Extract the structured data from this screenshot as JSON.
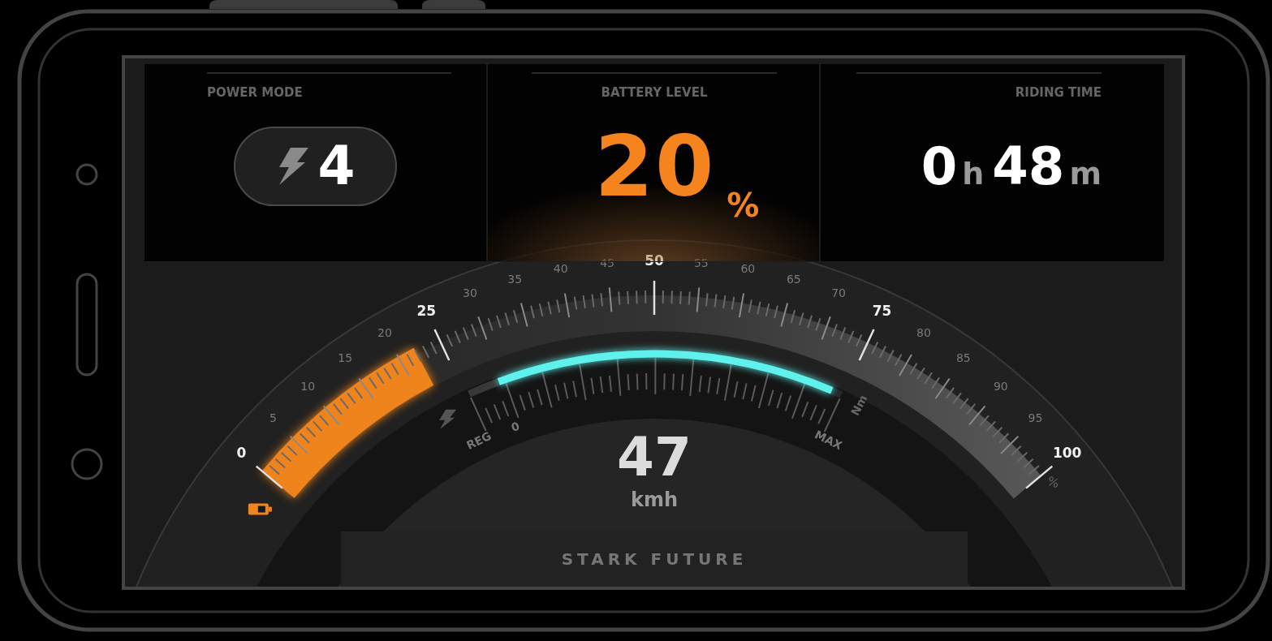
{
  "cards": [
    {
      "kind": "mode",
      "label": "POWER MODE",
      "value": "4"
    },
    {
      "kind": "battery",
      "label": "BATTERY LEVEL",
      "value": "20",
      "unit": "%"
    },
    {
      "kind": "time",
      "label": "RIDING TIME",
      "parts": [
        {
          "value": "0",
          "unit": "h"
        },
        {
          "value": "48",
          "unit": "m"
        }
      ]
    }
  ],
  "power_gauge": {
    "level": 0.22,
    "unit": "%",
    "labels": [
      {
        "text": "0",
        "major": true
      },
      {
        "text": "5",
        "major": false
      },
      {
        "text": "10",
        "major": false
      },
      {
        "text": "15",
        "major": false
      },
      {
        "text": "20",
        "major": false
      },
      {
        "text": "25",
        "major": true
      },
      {
        "text": "30",
        "major": false
      },
      {
        "text": "35",
        "major": false
      },
      {
        "text": "40",
        "major": false
      },
      {
        "text": "45",
        "major": false
      },
      {
        "text": "50",
        "major": true
      },
      {
        "text": "55",
        "major": false
      },
      {
        "text": "60",
        "major": false
      },
      {
        "text": "65",
        "major": false
      },
      {
        "text": "70",
        "major": false
      },
      {
        "text": "75",
        "major": true
      },
      {
        "text": "80",
        "major": false
      },
      {
        "text": "85",
        "major": false
      },
      {
        "text": "90",
        "major": false
      },
      {
        "text": "95",
        "major": false
      },
      {
        "text": "100",
        "major": true
      }
    ]
  },
  "torque_gauge": {
    "level": 0.97,
    "labels": [
      "REG",
      "0",
      "MAX"
    ],
    "unit": "Nm"
  },
  "speed": {
    "value": "47",
    "unit": "kmh"
  },
  "brand": "STARK FUTURE"
}
